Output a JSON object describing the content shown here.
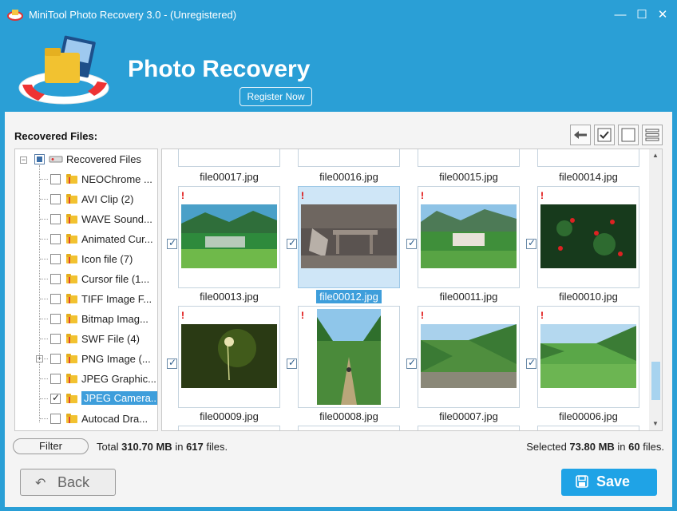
{
  "window": {
    "title": "MiniTool Photo Recovery 3.0 - (Unregistered)",
    "controls": {
      "minimize": "—",
      "maximize": "☐",
      "close": "✕"
    }
  },
  "header": {
    "brand": "Photo Recovery",
    "register_label": "Register Now"
  },
  "sidebar": {
    "heading": "Recovered Files:",
    "root_label": "Recovered Files",
    "items": [
      {
        "label": "NEOChrome ...",
        "checked": false
      },
      {
        "label": "AVI Clip (2)",
        "checked": false
      },
      {
        "label": "WAVE Sound...",
        "checked": false
      },
      {
        "label": "Animated Cur...",
        "checked": false
      },
      {
        "label": "Icon file (7)",
        "checked": false
      },
      {
        "label": "Cursor file (1...",
        "checked": false
      },
      {
        "label": "TIFF Image F...",
        "checked": false
      },
      {
        "label": "Bitmap Imag...",
        "checked": false
      },
      {
        "label": "SWF File (4)",
        "checked": false
      },
      {
        "label": "PNG Image (...",
        "checked": false
      },
      {
        "label": "JPEG Graphic...",
        "checked": false
      },
      {
        "label": "JPEG Camera...",
        "checked": true
      },
      {
        "label": "Autocad Dra...",
        "checked": false
      }
    ]
  },
  "toolbar": {
    "icons": [
      "arrow-left-icon",
      "check-all-icon",
      "uncheck-all-icon",
      "list-view-icon"
    ]
  },
  "grid": {
    "top_row": [
      "file00017.jpg",
      "file00016.jpg",
      "file00015.jpg",
      "file00014.jpg"
    ],
    "row1": [
      "file00013.jpg",
      "file00012.jpg",
      "file00011.jpg",
      "file00010.jpg"
    ],
    "row2": [
      "file00009.jpg",
      "file00008.jpg",
      "file00007.jpg",
      "file00006.jpg"
    ],
    "warning_mark": "!"
  },
  "footer": {
    "filter_label": "Filter",
    "total_prefix": "Total",
    "total_size": "310.70 MB",
    "total_mid": "in",
    "total_count": "617",
    "total_suffix": "files.",
    "selected_prefix": "Selected",
    "selected_size": "73.80 MB",
    "selected_mid": "in",
    "selected_count": "60",
    "selected_suffix": "files.",
    "back_label": "Back",
    "save_label": "Save"
  },
  "colors": {
    "accent": "#2a9fd6",
    "save_button": "#1fa3e6",
    "selection": "#3e9edb",
    "warning": "#dd0000"
  }
}
